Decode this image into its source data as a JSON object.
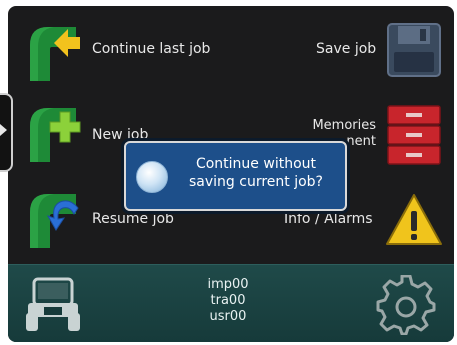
{
  "menu": {
    "continue_last_job": "Continue last job",
    "new_job": "New job",
    "resume_job": "Resume job",
    "save_job": "Save job",
    "memories_line1": "Memories",
    "memories_line2": "nent",
    "info_alarms": "Info / Alarms"
  },
  "dialog": {
    "line1": "Continue without",
    "line2": "saving current job?"
  },
  "status": {
    "line1": "imp00",
    "line2": "tra00",
    "line3": "usr00"
  },
  "colors": {
    "screen_bg": "#1b1b1c",
    "pipe_green": "#1e8a37",
    "arrow_yellow": "#f2c21d",
    "plus_green": "#8cd13a",
    "arrow_blue": "#2a6fd6",
    "dialog_blue": "#1d4f8a",
    "status_teal": "#1f4a49",
    "warning_yellow": "#f0c41c",
    "memory_red": "#c8252c"
  }
}
